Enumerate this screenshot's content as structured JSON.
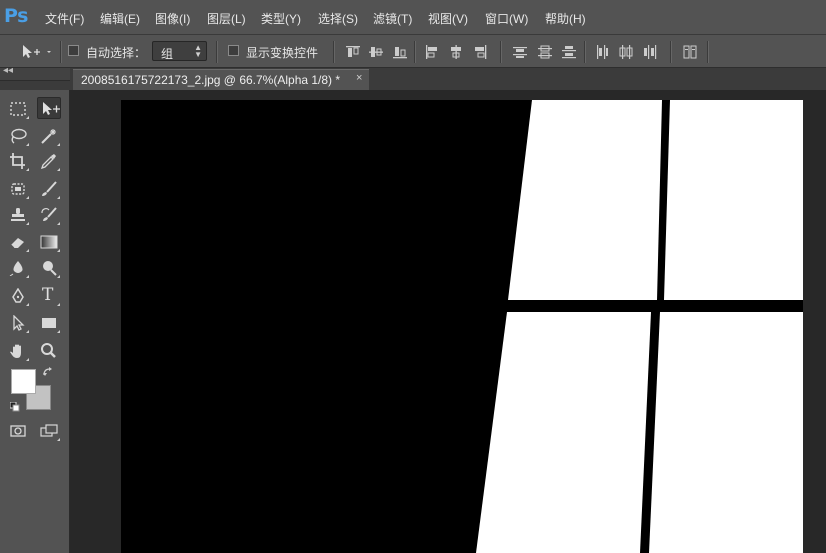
{
  "app": {
    "logo": "Ps",
    "accent_color": "#4a9fe6"
  },
  "menu": [
    {
      "label": "文件(F)"
    },
    {
      "label": "编辑(E)"
    },
    {
      "label": "图像(I)"
    },
    {
      "label": "图层(L)"
    },
    {
      "label": "类型(Y)"
    },
    {
      "label": "选择(S)"
    },
    {
      "label": "滤镜(T)"
    },
    {
      "label": "视图(V)"
    },
    {
      "label": "窗口(W)"
    },
    {
      "label": "帮助(H)"
    }
  ],
  "options": {
    "auto_select_label": "自动选择：",
    "auto_select_checked": false,
    "auto_select_value": "组",
    "show_transform_label": "显示变换控件",
    "show_transform_checked": false
  },
  "document": {
    "tab_title": "2008516175722173_2.jpg @ 66.7%(Alpha 1/8) *",
    "close_glyph": "×",
    "canvas_colors": {
      "background": "#000000",
      "panes": "#ffffff"
    }
  },
  "tools": {
    "header_glyph": "◂◂",
    "items": [
      {
        "name": "rectangular-marquee-icon"
      },
      {
        "name": "move-tool-icon",
        "selected": true
      },
      {
        "name": "lasso-icon"
      },
      {
        "name": "magic-wand-icon"
      },
      {
        "name": "crop-icon"
      },
      {
        "name": "eyedropper-icon"
      },
      {
        "name": "spot-healing-icon"
      },
      {
        "name": "brush-icon"
      },
      {
        "name": "clone-stamp-icon"
      },
      {
        "name": "history-brush-icon"
      },
      {
        "name": "eraser-icon"
      },
      {
        "name": "gradient-icon"
      },
      {
        "name": "blur-icon"
      },
      {
        "name": "dodge-icon"
      },
      {
        "name": "pen-icon"
      },
      {
        "name": "type-icon"
      },
      {
        "name": "path-selection-icon"
      },
      {
        "name": "rectangle-shape-icon"
      },
      {
        "name": "hand-icon"
      },
      {
        "name": "zoom-icon"
      },
      {
        "name": "quick-mask-icon"
      },
      {
        "name": "screen-mode-icon"
      }
    ],
    "type_tool_glyph": "T",
    "foreground_color": "#ffffff",
    "background_color": "#c2c2c2"
  }
}
